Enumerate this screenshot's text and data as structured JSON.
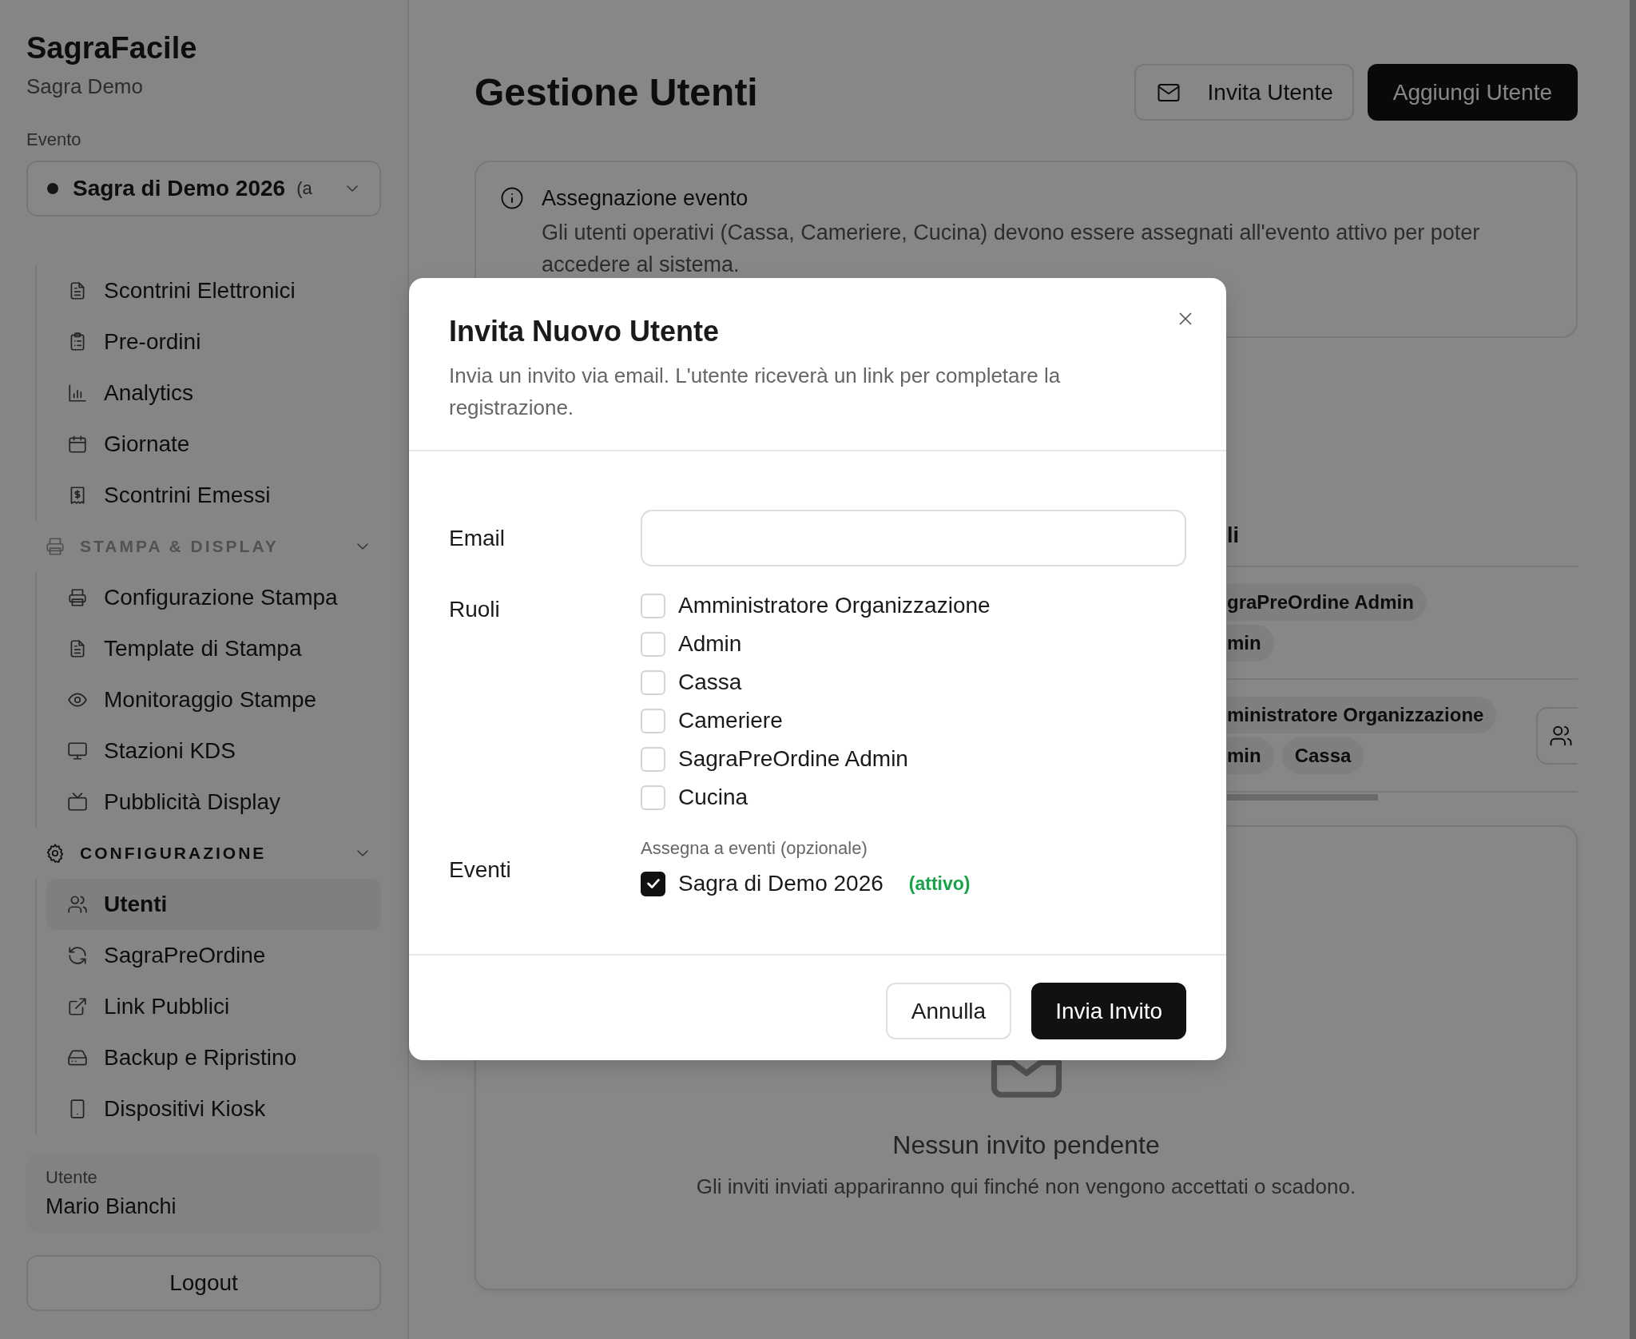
{
  "sidebar": {
    "app_name": "SagraFacile",
    "org_name": "Sagra Demo",
    "event_label": "Evento",
    "event_select": {
      "value": "Sagra di Demo 2026",
      "suffix": "(a"
    },
    "groups": [
      {
        "items": [
          {
            "label": "Scontrini Elettronici",
            "selected": false
          },
          {
            "label": "Pre-ordini",
            "selected": false
          },
          {
            "label": "Analytics",
            "selected": false
          },
          {
            "label": "Giornate",
            "selected": false
          },
          {
            "label": "Scontrini Emessi",
            "selected": false
          }
        ]
      },
      {
        "title": "STAMPA & DISPLAY",
        "active": false,
        "items": [
          {
            "label": "Configurazione Stampa",
            "selected": false
          },
          {
            "label": "Template di Stampa",
            "selected": false
          },
          {
            "label": "Monitoraggio Stampe",
            "selected": false
          },
          {
            "label": "Stazioni KDS",
            "selected": false
          },
          {
            "label": "Pubblicità Display",
            "selected": false
          }
        ]
      },
      {
        "title": "CONFIGURAZIONE",
        "active": true,
        "items": [
          {
            "label": "Utenti",
            "selected": true
          },
          {
            "label": "SagraPreOrdine",
            "selected": false
          },
          {
            "label": "Link Pubblici",
            "selected": false
          },
          {
            "label": "Backup e Ripristino",
            "selected": false
          },
          {
            "label": "Dispositivi Kiosk",
            "selected": false
          }
        ]
      }
    ],
    "user": {
      "label": "Utente",
      "name": "Mario Bianchi"
    },
    "logout": "Logout"
  },
  "main": {
    "title": "Gestione Utenti",
    "buttons": [
      {
        "label": "Invita Utente",
        "kind": "secondary"
      },
      {
        "label": "Aggiungi Utente",
        "kind": "primary"
      }
    ],
    "info": {
      "title": "Assegnazione evento",
      "text": "Gli utenti operativi (Cassa, Cameriere, Cucina) devono essere assegnati all'evento attivo per poter accedere al sistema."
    },
    "users_table": {
      "column_header": "li",
      "rows": [
        {
          "role_lines": [
            [
              "graPreOrdine Admin"
            ],
            [
              "min"
            ]
          ],
          "action": false
        },
        {
          "role_lines": [
            [
              "ministratore Organizzazione"
            ],
            [
              "min",
              "Cassa"
            ]
          ],
          "action": true
        }
      ]
    },
    "pending": {
      "title": "Nessun invito pendente",
      "text": "Gli inviti inviati appariranno qui finché non vengono accettati o scadono."
    }
  },
  "modal": {
    "title": "Invita Nuovo Utente",
    "description": "Invia un invito via email. L'utente riceverà un link per completare la registrazione.",
    "email": {
      "label": "Email"
    },
    "roles": {
      "label": "Ruoli",
      "options": [
        {
          "label": "Amministratore Organizzazione",
          "checked": false
        },
        {
          "label": "Admin",
          "checked": false
        },
        {
          "label": "Cassa",
          "checked": false
        },
        {
          "label": "Cameriere",
          "checked": false
        },
        {
          "label": "SagraPreOrdine Admin",
          "checked": false
        },
        {
          "label": "Cucina",
          "checked": false
        }
      ]
    },
    "events": {
      "label": "Eventi",
      "hint": "Assegna a eventi (opzionale)",
      "options": [
        {
          "label": "Sagra di Demo 2026",
          "badge": "(attivo)",
          "checked": true
        }
      ]
    },
    "buttons": [
      {
        "label": "Annulla",
        "kind": "secondary"
      },
      {
        "label": "Invia Invito",
        "kind": "primary"
      }
    ]
  }
}
